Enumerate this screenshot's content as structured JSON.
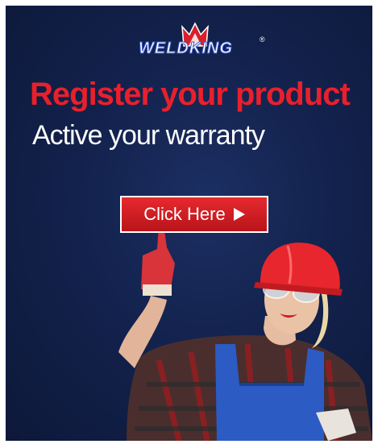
{
  "banner": {
    "logo_text": "WELDKING",
    "logo_reg": "®",
    "headline": "Register your product",
    "subline": "Active your warranty",
    "cta_label": "Click Here",
    "cta_icon": "play-arrow-icon",
    "colors": {
      "background": "#13224d",
      "headline": "#e8202c",
      "cta": "#d61f26"
    }
  }
}
